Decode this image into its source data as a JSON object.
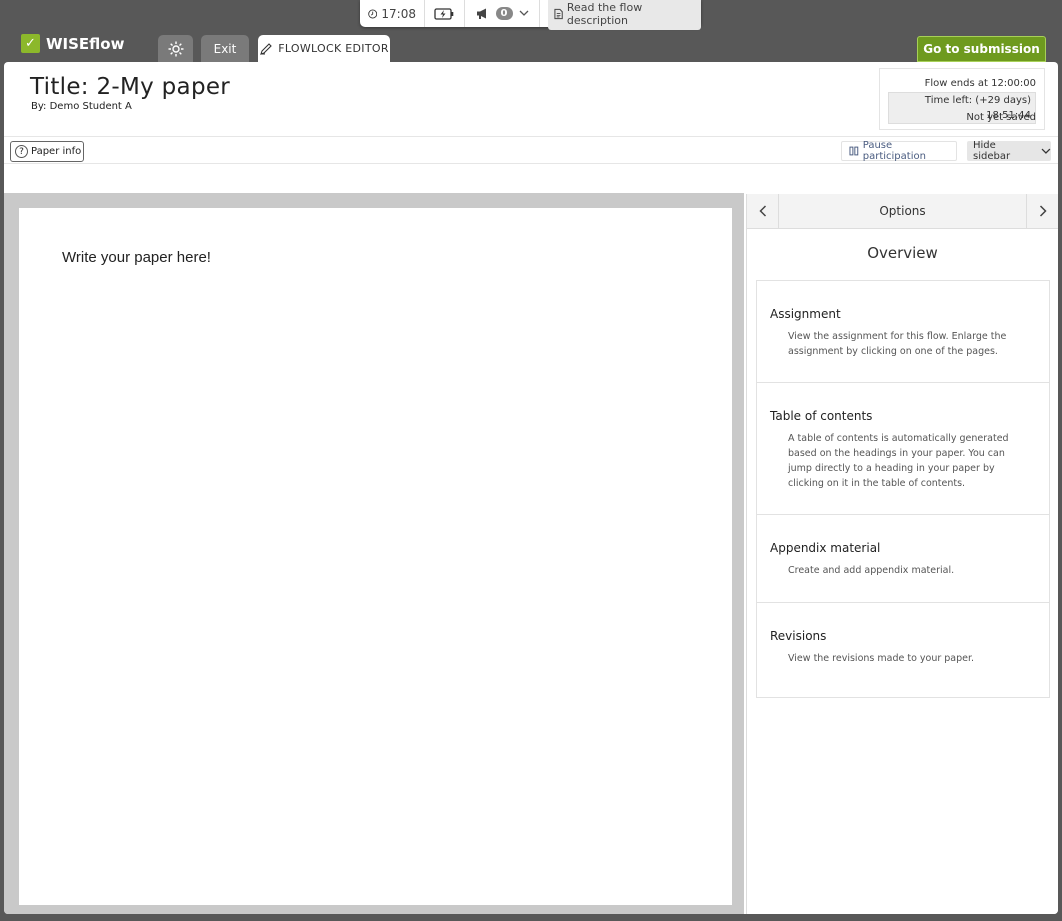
{
  "statusbar": {
    "time": "17:08",
    "notification_count": "0",
    "description_label": "Read the flow description"
  },
  "header": {
    "logo_text": "WISEflow",
    "exit_label": "Exit",
    "editor_tab_label": "FLOWLOCK EDITOR",
    "submission_label": "Go to submission"
  },
  "paper": {
    "title": "Title: 2-My paper",
    "byline": "By: Demo Student A",
    "placeholder": "Write your paper here!"
  },
  "flowinfo": {
    "ends": "Flow ends at 12:00:00",
    "time_left": "Time left: (+29 days) 18:51:44",
    "save_status": "Not yet saved"
  },
  "toolbar": {
    "paper_info": "Paper info",
    "pause": "Pause participation",
    "hide_sidebar": "Hide sidebar"
  },
  "sidebar": {
    "options_label": "Options",
    "overview_title": "Overview",
    "items": [
      {
        "title": "Assignment",
        "desc": "View the assignment for this flow. Enlarge the assignment by clicking on one of the pages."
      },
      {
        "title": "Table of contents",
        "desc": "A table of contents is automatically generated based on the headings in your paper. You can jump directly to a heading in your paper by clicking on it in the table of contents."
      },
      {
        "title": "Appendix material",
        "desc": "Create and add appendix material."
      },
      {
        "title": "Revisions",
        "desc": "View the revisions made to your paper."
      }
    ]
  },
  "colors": {
    "brand_green": "#6e9a1e",
    "chrome_gray": "#585858"
  }
}
